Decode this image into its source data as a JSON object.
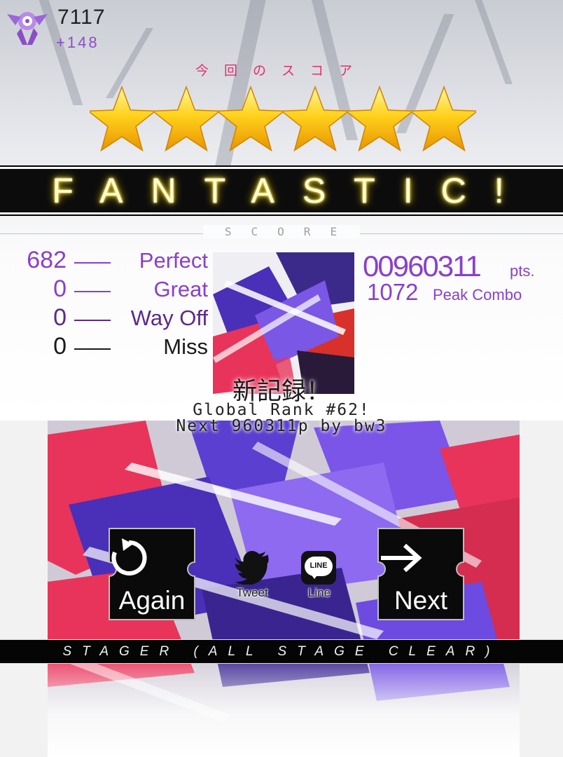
{
  "player": {
    "points": "7117",
    "points_delta": "+148",
    "badge_icon": "ribbon-emblem-icon"
  },
  "result": {
    "caption": "今回のスコア",
    "star_count": 6,
    "rank_label": "FANTASTIC!"
  },
  "score": {
    "heading": "SCORE",
    "judgements": [
      {
        "count": "682",
        "label": "Perfect",
        "color": "#8a3fcc"
      },
      {
        "count": "0",
        "label": "Great",
        "color": "#8a3fcc"
      },
      {
        "count": "0",
        "label": "Way Off",
        "color": "#5a2a8a"
      },
      {
        "count": "0",
        "label": "Miss",
        "color": "#1a1a1a"
      }
    ],
    "value": "00960311",
    "unit": "pts.",
    "peak_combo": "1072",
    "peak_combo_label": "Peak Combo",
    "accent_color": "#8a3fcc"
  },
  "record": {
    "new_record": "新記録！",
    "global_rank": "Global Rank #62!",
    "next_target": "Next 960311p by bw3"
  },
  "actions": {
    "again_label": "Again",
    "next_label": "Next",
    "tweet_label": "Tweet",
    "line_label": "Line",
    "line_badge": "LINE"
  },
  "stage": {
    "banner": "STAGER (ALL STAGE CLEAR)"
  }
}
